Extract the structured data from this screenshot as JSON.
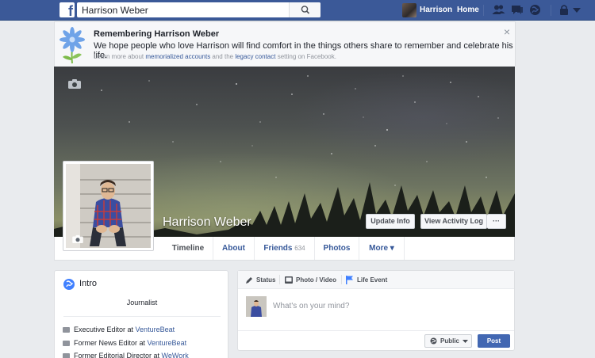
{
  "topbar": {
    "search_value": "Harrison Weber",
    "user_name": "Harrison",
    "home_label": "Home",
    "logo_letter": "f",
    "brand_color": "#3b5998",
    "icons": [
      "search-icon",
      "friend-requests-icon",
      "messages-icon",
      "notifications-globe-icon",
      "privacy-lock-icon",
      "account-menu-icon"
    ]
  },
  "memorial": {
    "title": "Remembering Harrison Weber",
    "text": "We hope people who love Harrison will find comfort in the things others share to remember and celebrate his life.",
    "more_prefix": "Learn more about ",
    "more_link1": "memorialized accounts",
    "more_middle": " and the ",
    "more_link2": "legacy contact",
    "more_suffix": " setting on Facebook.",
    "close": "×"
  },
  "profile": {
    "name": "Harrison Weber",
    "update_info": "Update Info",
    "view_activity": "View Activity Log",
    "more_dots": "···"
  },
  "tabs": {
    "timeline": "Timeline",
    "about": "About",
    "friends": "Friends",
    "friends_count": "634",
    "photos": "Photos",
    "more": "More ▾"
  },
  "intro": {
    "title": "Intro",
    "bio": "Journalist",
    "jobs": [
      {
        "role": "Executive Editor at ",
        "org": "VentureBeat"
      },
      {
        "role": "Former News Editor at ",
        "org": "VentureBeat"
      },
      {
        "role": "Former Editorial Director at ",
        "org": "WeWork"
      }
    ]
  },
  "composer": {
    "status": "Status",
    "photo_video": "Photo / Video",
    "life_event": "Life Event",
    "placeholder": "What's on your mind?",
    "audience": "Public",
    "post": "Post"
  }
}
